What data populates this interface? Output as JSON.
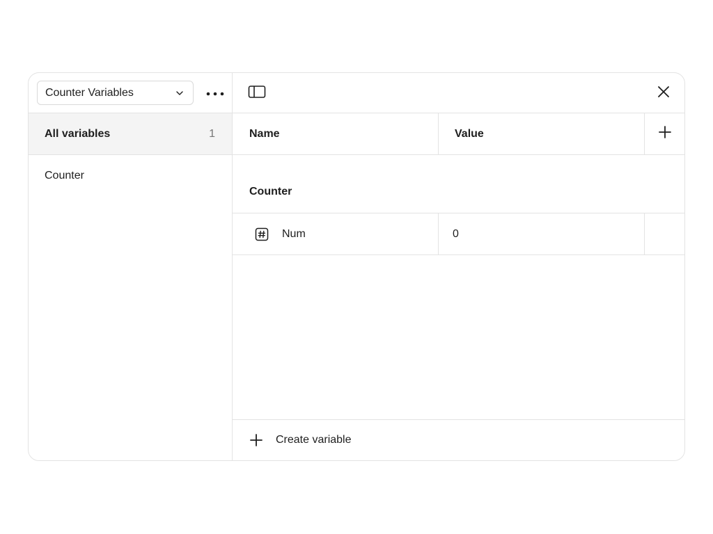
{
  "sidebar": {
    "collection_select": {
      "label": "Counter Variables",
      "icon": "chevron-down-icon"
    },
    "more_icon": "more-horizontal-icon",
    "items": [
      {
        "label": "All variables",
        "count": "1",
        "active": true
      },
      {
        "label": "Counter",
        "active": false
      }
    ]
  },
  "header": {
    "toggle_icon": "sidebar-toggle-icon",
    "close_icon": "close-icon"
  },
  "table": {
    "columns": [
      "Name",
      "Value"
    ],
    "add_column_icon": "plus-icon",
    "group": "Counter",
    "rows": [
      {
        "type_icon": "number-icon",
        "name": "Num",
        "value": "0"
      }
    ]
  },
  "footer": {
    "label": "Create variable",
    "icon": "plus-icon"
  }
}
